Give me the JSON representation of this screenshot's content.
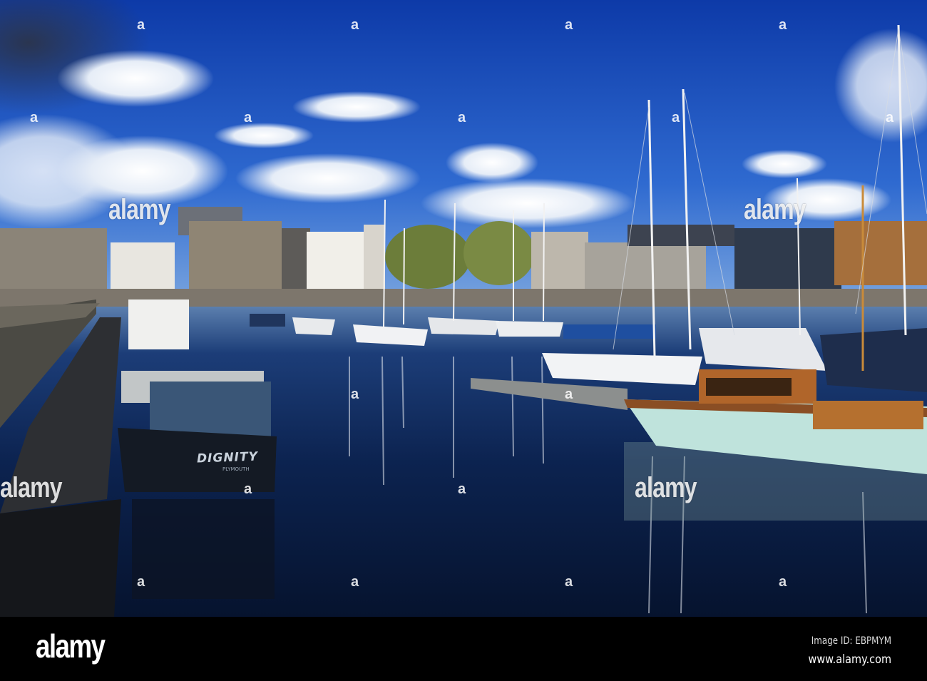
{
  "photo": {
    "boat_name": "DIGNITY",
    "boat_port": "PLYMOUTH",
    "colors": {
      "sky_top": "#0f3fae",
      "sky_bottom": "#4f86d6",
      "water": "#0a1a3c",
      "hull_mint": "#bfe3dc",
      "cabin_wood": "#b0652a"
    }
  },
  "watermark": {
    "text": "alamy",
    "mark": "a"
  },
  "footer": {
    "logo": "alamy",
    "image_id": "Image ID: EBPMYM",
    "website": "www.alamy.com"
  }
}
